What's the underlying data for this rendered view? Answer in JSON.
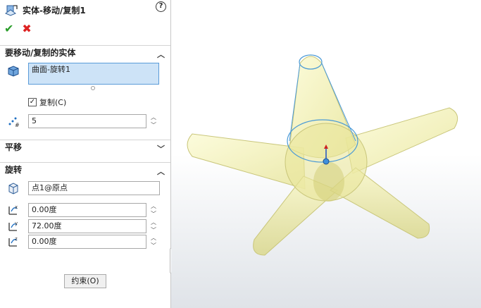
{
  "panel": {
    "title": "实体-移动/复制1",
    "help_label": "?",
    "ok_label": "✔",
    "cancel_label": "✖",
    "bodies_section": {
      "title": "要移动/复制的实体",
      "selected_body": "曲面-旋转1",
      "copy_label": "复制(C)",
      "copy_checked": true,
      "copy_count": "5"
    },
    "translate_section": {
      "title": "平移"
    },
    "rotate_section": {
      "title": "旋转",
      "center_point": "点1@原点",
      "angle_x": "0.00度",
      "angle_y": "72.00度",
      "angle_z": "0.00度"
    },
    "constraints_button": "约束(O)"
  },
  "colors": {
    "selection_fill": "#cde3f7",
    "selection_border": "#5a9bd8",
    "model_fill": "#f3f1a6",
    "model_edge": "#c9c67a",
    "highlight_edge": "#4a9ad6"
  }
}
